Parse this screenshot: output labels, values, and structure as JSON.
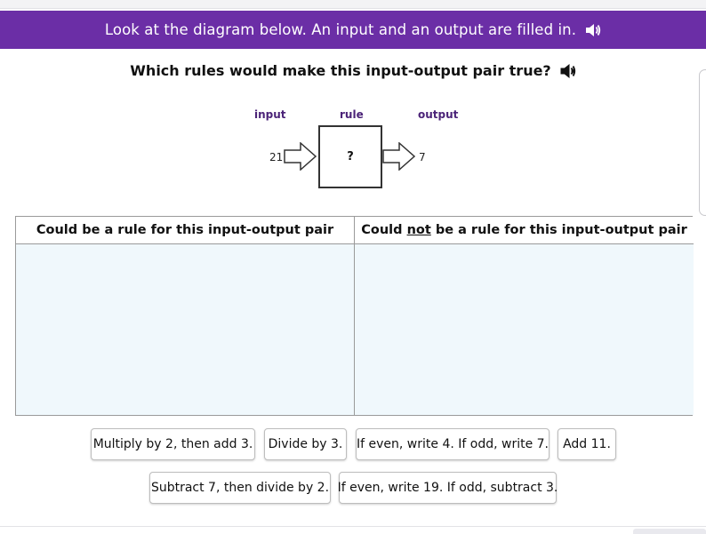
{
  "banner": {
    "text": "Look at the diagram below. An input and an output are filled in."
  },
  "question": {
    "text": "Which rules would make this input-output pair true?"
  },
  "diagram": {
    "input_label": "input",
    "rule_label": "rule",
    "output_label": "output",
    "input_value": "21",
    "rule_value": "?",
    "output_value": "7"
  },
  "table": {
    "left_header": "Could be a rule for this input-output pair",
    "right_header_pre": "Could ",
    "right_header_emph": "not",
    "right_header_post": " be a rule for this input-output pair"
  },
  "tiles": [
    "Multiply by 2, then add 3.",
    "Divide by 3.",
    "If even, write 4. If odd, write 7.",
    "Add 11.",
    "Subtract 7, then divide by 2.",
    "If even, write 19. If odd, subtract 3."
  ],
  "colors": {
    "banner": "#6b2ea6",
    "label": "#4b2378",
    "drop_zone": "#f0f8fc"
  }
}
